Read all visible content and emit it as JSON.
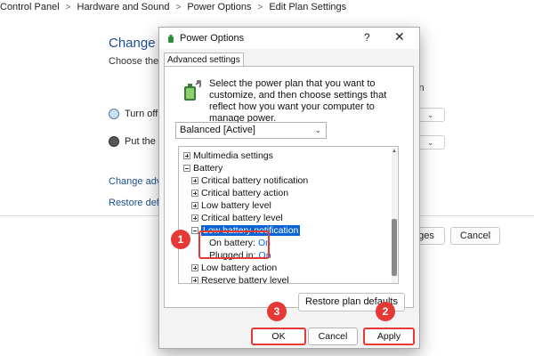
{
  "breadcrumb": {
    "items": [
      "Control Panel",
      "Hardware and Sound",
      "Power Options",
      "Edit Plan Settings"
    ]
  },
  "background": {
    "title": "Change se",
    "subtitle": "Choose the sl",
    "subtitle_right": "in",
    "row1_label": "Turn off t",
    "row2_label": "Put the co",
    "link1": "Change advan",
    "link2": "Restore defau",
    "save_partial": "nges",
    "cancel": "Cancel"
  },
  "dialog": {
    "title": "Power Options",
    "help_glyph": "?",
    "close_glyph": "✕",
    "tab": "Advanced settings",
    "description": "Select the power plan that you want to customize, and then choose settings that reflect how you want your computer to manage power.",
    "plan_selected": "Balanced [Active]",
    "tree": [
      {
        "label": "Multimedia settings",
        "exp": "plus"
      },
      {
        "label": "Battery",
        "exp": "minus"
      },
      {
        "label": "Critical battery notification",
        "exp": "plus"
      },
      {
        "label": "Critical battery action",
        "exp": "plus"
      },
      {
        "label": "Low battery level",
        "exp": "plus"
      },
      {
        "label": "Critical battery level",
        "exp": "plus"
      },
      {
        "label": "Low battery notification",
        "exp": "minus"
      },
      {
        "label": "On battery:",
        "value": "On"
      },
      {
        "label": "Plugged in:",
        "value": "On"
      },
      {
        "label": "Low battery action",
        "exp": "plus"
      },
      {
        "label": "Reserve battery level",
        "exp": "plus"
      }
    ],
    "restore_button": "Restore plan defaults",
    "ok": "OK",
    "cancel": "Cancel",
    "apply": "Apply"
  },
  "callouts": {
    "step1": "1",
    "step2": "2",
    "step3": "3"
  },
  "colors": {
    "accent": "#0a64d6",
    "callout": "#e53935",
    "link": "#1d4f91"
  }
}
